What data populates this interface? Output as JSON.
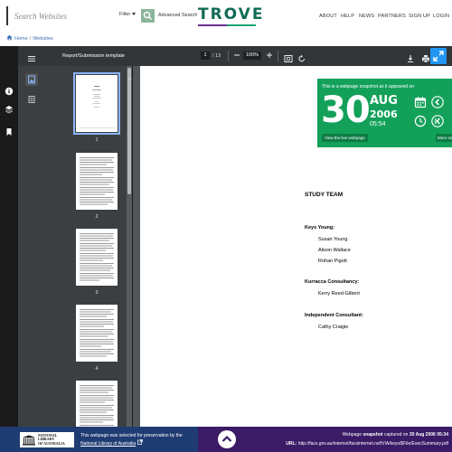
{
  "header": {
    "search_placeholder": "Search Websites",
    "filter_label": "Filter",
    "advanced_search_label": "Advanced Search",
    "logo_text": "TROVE",
    "nav": [
      "ABOUT",
      "HELP",
      "NEWS",
      "PARTNERS",
      "SIGN UP",
      "LOGIN"
    ]
  },
  "breadcrumb": {
    "home": "Home",
    "current": "Websites"
  },
  "pdf_viewer": {
    "title": "Report/Submission template",
    "current_page": "1",
    "page_total": "/ 13",
    "zoom": "100%",
    "thumbnail_labels": [
      "1",
      "2",
      "3",
      "4"
    ]
  },
  "document": {
    "heading": "STUDY TEAM",
    "sections": [
      {
        "title": "Keys Young:",
        "members": [
          "Susan Young",
          "Alison Wallace",
          "Rohan Pigott"
        ]
      },
      {
        "title": "Kurracca Consultancy:",
        "members": [
          "Kerry Reed-Gilbert"
        ]
      },
      {
        "title": "Independent Consultant:",
        "members": [
          "Cathy Craigie"
        ]
      }
    ]
  },
  "snapshot_banner": {
    "caption": "This is a webpage snapshot as it appeared on",
    "day": "30",
    "month": "AUG",
    "year": "2006",
    "time": "05:54",
    "live_button": "View the live webpage",
    "more_button": "More sn"
  },
  "footer": {
    "nla_logo_lines": [
      "NATIONAL",
      "LIBRARY",
      "OF AUSTRALIA"
    ],
    "note_text": "This webpage was selected for preservation by the",
    "note_link": "National Library of Australia",
    "snapshot_prefix": "Webpage",
    "snapshot_bold": "snapshot",
    "snapshot_mid": "captured on",
    "snapshot_date": "30 Aug 2006 05:34",
    "url_label": "URL:",
    "url": "http://facs.gov.au/internet/facsinternet.nsf/VIA/keys/$File/ExecSummary.pdf"
  },
  "colors": {
    "trove_green": "#0f6b55",
    "trove_purple": "#612e8f",
    "snapshot_green": "#13a15a",
    "footer_blue": "#1f3c72",
    "footer_purple": "#3b1a66"
  }
}
